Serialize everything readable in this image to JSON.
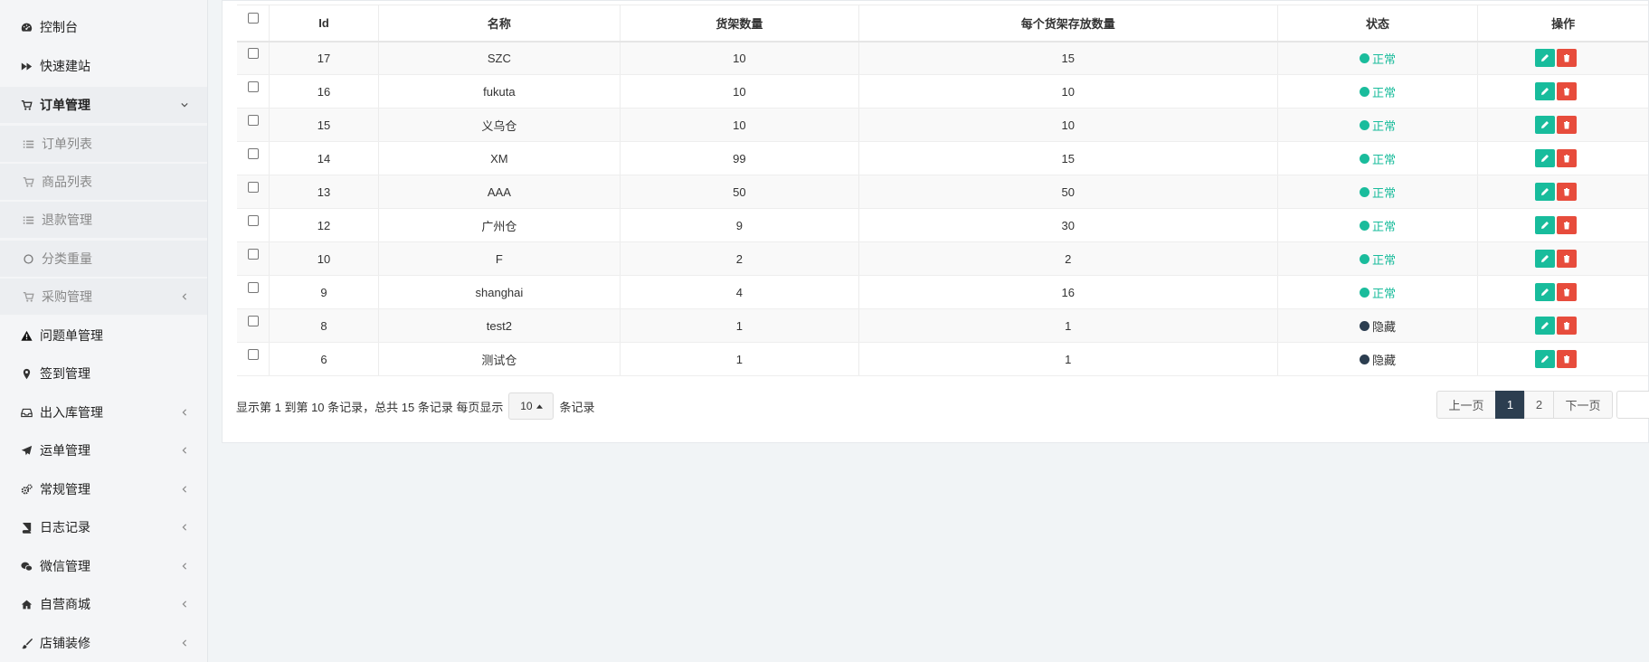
{
  "sidebar": {
    "items": [
      {
        "label": "控制台",
        "icon": "dashboard-icon"
      },
      {
        "label": "快速建站",
        "icon": "fast-forward-icon"
      },
      {
        "label": "订单管理",
        "icon": "cart-icon"
      },
      {
        "label": "订单列表",
        "icon": "list-icon"
      },
      {
        "label": "商品列表",
        "icon": "cart-icon"
      },
      {
        "label": "退款管理",
        "icon": "list-icon"
      },
      {
        "label": "分类重量",
        "icon": "circle-icon"
      },
      {
        "label": "采购管理",
        "icon": "cart-icon"
      },
      {
        "label": "问题单管理",
        "icon": "warning-icon"
      },
      {
        "label": "签到管理",
        "icon": "map-marker-icon"
      },
      {
        "label": "出入库管理",
        "icon": "inbox-icon"
      },
      {
        "label": "运单管理",
        "icon": "plane-icon"
      },
      {
        "label": "常规管理",
        "icon": "cogs-icon"
      },
      {
        "label": "日志记录",
        "icon": "book-icon"
      },
      {
        "label": "微信管理",
        "icon": "wechat-icon"
      },
      {
        "label": "自营商城",
        "icon": "home-icon"
      },
      {
        "label": "店铺装修",
        "icon": "brush-icon"
      }
    ]
  },
  "table": {
    "headers": [
      "Id",
      "名称",
      "货架数量",
      "每个货架存放数量",
      "状态",
      "操作"
    ],
    "rows": [
      {
        "id": "17",
        "name": "SZC",
        "shelves": "10",
        "per_shelf": "15",
        "status": "正常"
      },
      {
        "id": "16",
        "name": "fukuta",
        "shelves": "10",
        "per_shelf": "10",
        "status": "正常"
      },
      {
        "id": "15",
        "name": "义乌仓",
        "shelves": "10",
        "per_shelf": "10",
        "status": "正常"
      },
      {
        "id": "14",
        "name": "XM",
        "shelves": "99",
        "per_shelf": "15",
        "status": "正常"
      },
      {
        "id": "13",
        "name": "AAA",
        "shelves": "50",
        "per_shelf": "50",
        "status": "正常"
      },
      {
        "id": "12",
        "name": "广州仓",
        "shelves": "9",
        "per_shelf": "30",
        "status": "正常"
      },
      {
        "id": "10",
        "name": "F",
        "shelves": "2",
        "per_shelf": "2",
        "status": "正常"
      },
      {
        "id": "9",
        "name": "shanghai",
        "shelves": "4",
        "per_shelf": "16",
        "status": "正常"
      },
      {
        "id": "8",
        "name": "test2",
        "shelves": "1",
        "per_shelf": "1",
        "status": "隐藏"
      },
      {
        "id": "6",
        "name": "测试仓",
        "shelves": "1",
        "per_shelf": "1",
        "status": "隐藏"
      }
    ]
  },
  "footer": {
    "info_prefix": "显示第 1 到第 10 条记录，总共 15 条记录 每页显示",
    "page_size": "10",
    "info_suffix": "条记录"
  },
  "pagination": {
    "prev": "上一页",
    "pages": [
      "1",
      "2"
    ],
    "current": "1",
    "next": "下一页"
  },
  "colors": {
    "normal": "#1abc9c",
    "hidden": "#2c3e50",
    "edit": "#18bc9c",
    "delete": "#e74c3c",
    "active_page": "#2c3e50"
  }
}
